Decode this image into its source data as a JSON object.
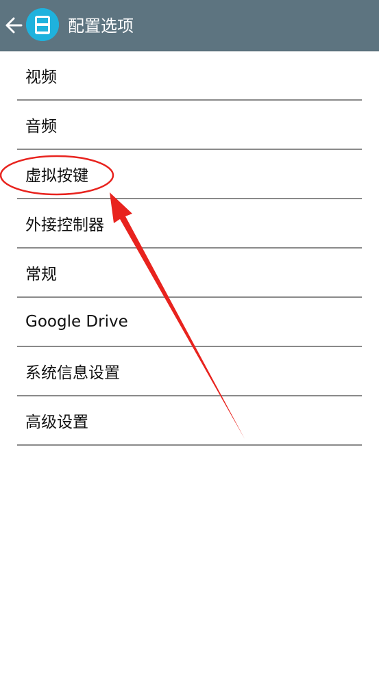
{
  "appbar": {
    "title": "配置选项",
    "back_icon": "arrow-left-icon",
    "app_icon": "ds-console-icon",
    "color": "#5d7480",
    "icon_color": "#1fb2dd"
  },
  "menu": {
    "items": [
      {
        "label": "视频"
      },
      {
        "label": "音频"
      },
      {
        "label": "虚拟按键"
      },
      {
        "label": "外接控制器"
      },
      {
        "label": "常规"
      },
      {
        "label": "Google Drive"
      },
      {
        "label": "系统信息设置"
      },
      {
        "label": "高级设置"
      }
    ]
  },
  "annotation": {
    "color": "#e8231e",
    "highlighted_item": "虚拟按键",
    "shapes": [
      "highlight-ellipse",
      "pointer-arrow"
    ]
  }
}
